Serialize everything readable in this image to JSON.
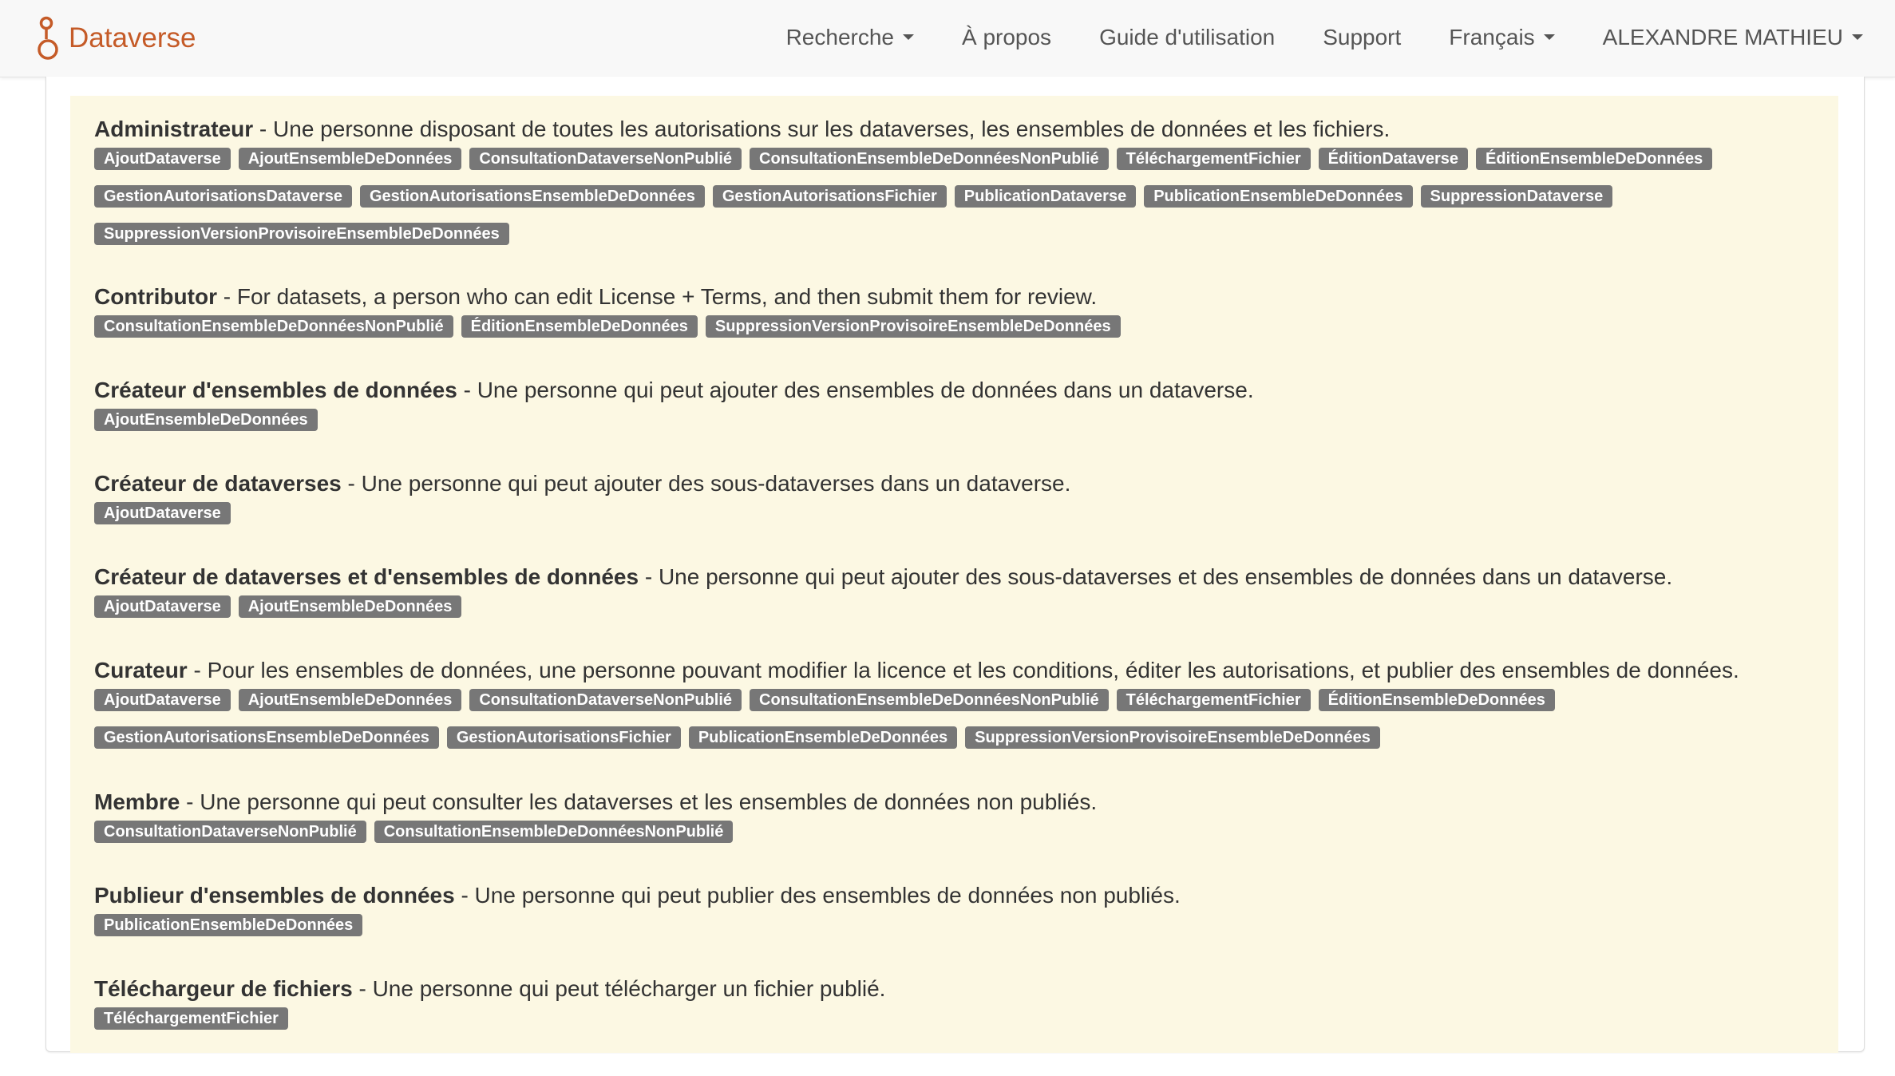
{
  "navbar": {
    "brand_label": "Dataverse",
    "items": [
      {
        "label": "Recherche",
        "has_caret": true
      },
      {
        "label": "À propos",
        "has_caret": false
      },
      {
        "label": "Guide d'utilisation",
        "has_caret": false
      },
      {
        "label": "Support",
        "has_caret": false
      },
      {
        "label": "Français",
        "has_caret": true
      },
      {
        "label": "ALEXANDRE MATHIEU",
        "has_caret": true
      }
    ]
  },
  "colors": {
    "brand": "#c55b28",
    "role_background": "#fcf8e3",
    "tag_background": "#777777"
  },
  "icons": {
    "brand_logo": "dataverse-logo-icon",
    "dropdown": "caret-down-icon"
  },
  "roles": [
    {
      "name": "Administrateur",
      "description": " - Une personne disposant de toutes les autorisations sur les dataverses, les ensembles de données et les fichiers.",
      "permissions": [
        "AjoutDataverse",
        "AjoutEnsembleDeDonnées",
        "ConsultationDataverseNonPublié",
        "ConsultationEnsembleDeDonnéesNonPublié",
        "TéléchargementFichier",
        "ÉditionDataverse",
        "ÉditionEnsembleDeDonnées",
        "GestionAutorisationsDataverse",
        "GestionAutorisationsEnsembleDeDonnées",
        "GestionAutorisationsFichier",
        "PublicationDataverse",
        "PublicationEnsembleDeDonnées",
        "SuppressionDataverse",
        "SuppressionVersionProvisoireEnsembleDeDonnées"
      ]
    },
    {
      "name": "Contributor",
      "description": " - For datasets, a person who can edit License + Terms, and then submit them for review.",
      "permissions": [
        "ConsultationEnsembleDeDonnéesNonPublié",
        "ÉditionEnsembleDeDonnées",
        "SuppressionVersionProvisoireEnsembleDeDonnées"
      ]
    },
    {
      "name": "Créateur d'ensembles de données",
      "description": " - Une personne qui peut ajouter des ensembles de données dans un dataverse.",
      "permissions": [
        "AjoutEnsembleDeDonnées"
      ]
    },
    {
      "name": "Créateur de dataverses",
      "description": " - Une personne qui peut ajouter des sous-dataverses dans un dataverse.",
      "permissions": [
        "AjoutDataverse"
      ]
    },
    {
      "name": "Créateur de dataverses et d'ensembles de données",
      "description": " - Une personne qui peut ajouter des sous-dataverses et des ensembles de données dans un dataverse.",
      "permissions": [
        "AjoutDataverse",
        "AjoutEnsembleDeDonnées"
      ]
    },
    {
      "name": "Curateur",
      "description": " - Pour les ensembles de données, une personne pouvant modifier la licence et les conditions, éditer les autorisations, et publier des ensembles de données.",
      "permissions": [
        "AjoutDataverse",
        "AjoutEnsembleDeDonnées",
        "ConsultationDataverseNonPublié",
        "ConsultationEnsembleDeDonnéesNonPublié",
        "TéléchargementFichier",
        "ÉditionEnsembleDeDonnées",
        "GestionAutorisationsEnsembleDeDonnées",
        "GestionAutorisationsFichier",
        "PublicationEnsembleDeDonnées",
        "SuppressionVersionProvisoireEnsembleDeDonnées"
      ]
    },
    {
      "name": "Membre",
      "description": " - Une personne qui peut consulter les dataverses et les ensembles de données non publiés.",
      "permissions": [
        "ConsultationDataverseNonPublié",
        "ConsultationEnsembleDeDonnéesNonPublié"
      ]
    },
    {
      "name": "Publieur d'ensembles de données",
      "description": " - Une personne qui peut publier des ensembles de données non publiés.",
      "permissions": [
        "PublicationEnsembleDeDonnées"
      ]
    },
    {
      "name": "Téléchargeur de fichiers",
      "description": " - Une personne qui peut télécharger un fichier publié.",
      "permissions": [
        "TéléchargementFichier"
      ]
    }
  ]
}
